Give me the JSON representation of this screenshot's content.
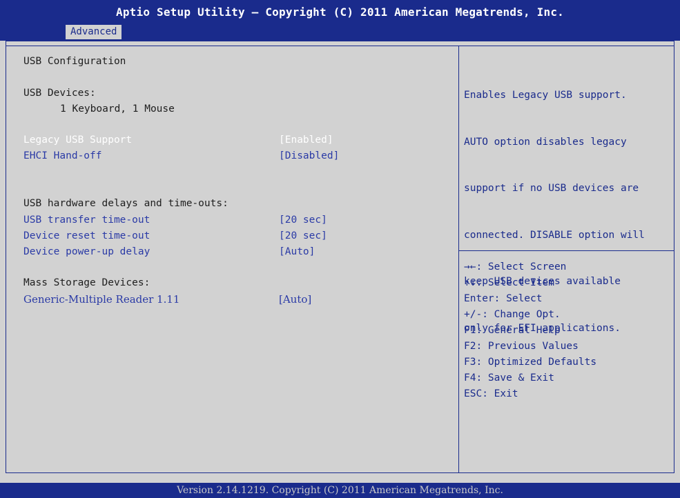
{
  "header": {
    "title": "Aptio Setup Utility – Copyright (C) 2011 American Megatrends, Inc.",
    "tabs": [
      {
        "label": "Advanced",
        "active": true
      }
    ]
  },
  "main": {
    "section_title": "USB Configuration",
    "usb_devices_label": "USB Devices:",
    "usb_devices_value": "1 Keyboard, 1 Mouse",
    "settings": [
      {
        "label": "Legacy USB Support",
        "value": "[Enabled]",
        "selected": true
      },
      {
        "label": "EHCI Hand-off",
        "value": "[Disabled]"
      }
    ],
    "delays_label": "USB hardware delays and time-outs:",
    "delays": [
      {
        "label": "USB transfer time-out",
        "value": "[20 sec]"
      },
      {
        "label": "Device reset time-out",
        "value": "[20 sec]"
      },
      {
        "label": "Device power-up delay",
        "value": "[Auto]"
      }
    ],
    "mass_storage_label": "Mass Storage Devices:",
    "mass_storage": [
      {
        "label": "Generic-Multiple Reader 1.11",
        "value": "[Auto]"
      }
    ]
  },
  "help": {
    "text_lines": [
      "Enables Legacy USB support.",
      "AUTO option disables legacy",
      "support if no USB devices are",
      "connected. DISABLE option will",
      "keep USB devices available",
      "only for EFI applications."
    ]
  },
  "keys": [
    {
      "key": "→←",
      "action": ": Select Screen"
    },
    {
      "key": "↑↓",
      "action": ": Select Item"
    },
    {
      "key": "Enter",
      "action": ": Select"
    },
    {
      "key": "+/-",
      "action": ": Change Opt."
    },
    {
      "key": "F1",
      "action": ": General Help"
    },
    {
      "key": "F2",
      "action": ": Previous Values"
    },
    {
      "key": "F3",
      "action": ": Optimized Defaults"
    },
    {
      "key": "F4",
      "action": ": Save & Exit"
    },
    {
      "key": "ESC",
      "action": ": Exit"
    }
  ],
  "footer": {
    "text": "Version 2.14.1219. Copyright (C) 2011 American Megatrends, Inc."
  },
  "colors": {
    "header_bg": "#1a2b8c",
    "screen_bg": "#d2d2d2",
    "item_blue": "#2a3aa6",
    "selected_text": "#ffffff"
  }
}
